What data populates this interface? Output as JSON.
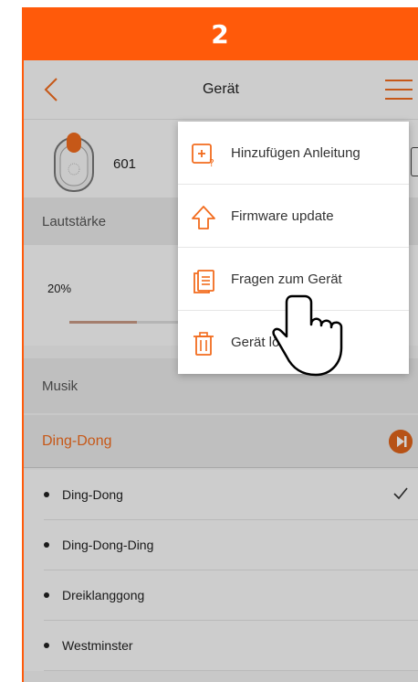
{
  "step": {
    "number": "2"
  },
  "header": {
    "title": "Gerät"
  },
  "device": {
    "name": "601"
  },
  "volume": {
    "section_label": "Lautstärke",
    "value_label": "20%",
    "level_fraction": 0.2
  },
  "music": {
    "section_label": "Musik",
    "selected_melody": "Ding-Dong"
  },
  "songs": [
    {
      "label": "Ding-Dong",
      "selected": true
    },
    {
      "label": "Ding-Dong-Ding",
      "selected": false
    },
    {
      "label": "Dreiklanggong",
      "selected": false
    },
    {
      "label": "Westminster",
      "selected": false
    }
  ],
  "menu": {
    "items": [
      {
        "label": "Hinzufügen Anleitung",
        "icon": "add-help-icon"
      },
      {
        "label": "Firmware update",
        "icon": "upload-arrow-icon"
      },
      {
        "label": "Fragen zum Gerät",
        "icon": "document-icon"
      },
      {
        "label": "Gerät lös",
        "icon": "trash-icon"
      }
    ]
  },
  "colors": {
    "accent": "#ff5a0a",
    "accent_text": "#f26c1e",
    "menu_icon": "#f26c1e"
  }
}
